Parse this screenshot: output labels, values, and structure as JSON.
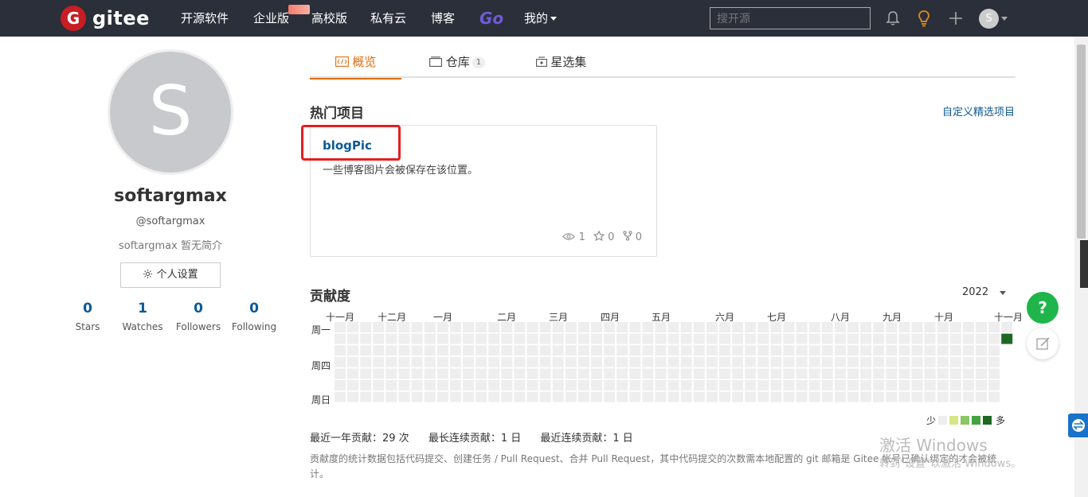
{
  "header": {
    "brand": "gitee",
    "logo_letter": "G",
    "nav": [
      "开源软件",
      "企业版",
      "高校版",
      "私有云",
      "博客",
      "Go",
      "我的"
    ],
    "search_placeholder": "搜开源",
    "user_initial": "S"
  },
  "profile": {
    "avatar_letter": "S",
    "name": "softargmax",
    "handle": "@softargmax",
    "bio": "softargmax 暂无简介",
    "settings_label": "个人设置",
    "stats": [
      {
        "num": "0",
        "label": "Stars"
      },
      {
        "num": "1",
        "label": "Watches"
      },
      {
        "num": "0",
        "label": "Followers"
      },
      {
        "num": "0",
        "label": "Following"
      }
    ]
  },
  "tabs": [
    {
      "label": "概览",
      "active": true
    },
    {
      "label": "仓库",
      "count": "1"
    },
    {
      "label": "星选集"
    }
  ],
  "hot": {
    "title": "热门项目",
    "custom_link": "自定义精选项目",
    "project": {
      "name": "blogPic",
      "desc": "一些博客图片会被保存在该位置。",
      "watches": "1",
      "stars": "0",
      "forks": "0"
    }
  },
  "contrib": {
    "title": "贡献度",
    "year": "2022",
    "months": [
      "十一月",
      "十二月",
      "一月",
      "二月",
      "三月",
      "四月",
      "五月",
      "六月",
      "七月",
      "八月",
      "九月",
      "十月",
      "十一月"
    ],
    "weekdays": [
      "周一",
      "周四",
      "周日"
    ],
    "legend_less": "少",
    "legend_more": "多",
    "legend_colors": [
      "#eeeeee",
      "#d6e685",
      "#8cc665",
      "#44a340",
      "#1e6823"
    ],
    "summary": [
      "最近一年贡献：29 次",
      "最长连续贡献：1 日",
      "最近连续贡献：1 日"
    ],
    "note": "贡献度的统计数据包括代码提交、创建任务 / Pull Request、合并 Pull Request，其中代码提交的次数需本地配置的 git 邮箱是 Gitee 帐号已确认绑定的才会被统计。"
  },
  "watermark": {
    "line1": "激活 Windows",
    "line2": "转到\"设置\"以激活 Windows。"
  },
  "help_label": "?"
}
